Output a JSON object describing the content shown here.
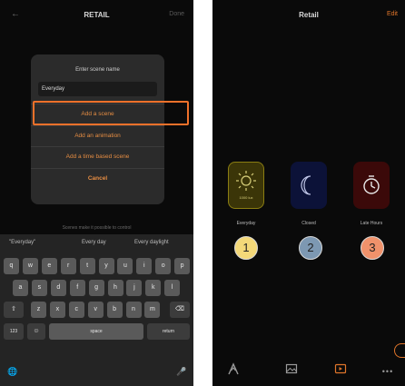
{
  "left_screen": {
    "header": {
      "back_icon": "arrow-left-icon",
      "title": "RETAIL",
      "done_label": "Done"
    },
    "dialog": {
      "title": "Enter scene name",
      "input_value": "Everyday",
      "options": [
        "Add a scene",
        "Add an animation",
        "Add a time based scene"
      ],
      "cancel_label": "Cancel"
    },
    "hint": "Scenes make it possible to control",
    "keyboard": {
      "suggestions": [
        "\"Everyday\"",
        "Every day",
        "Every daylight"
      ],
      "row1": [
        "q",
        "w",
        "e",
        "r",
        "t",
        "y",
        "u",
        "i",
        "o",
        "p"
      ],
      "row2": [
        "a",
        "s",
        "d",
        "f",
        "g",
        "h",
        "j",
        "k",
        "l"
      ],
      "row3": [
        "z",
        "x",
        "c",
        "v",
        "b",
        "n",
        "m"
      ],
      "numbers_label": "123",
      "space_label": "space",
      "return_label": "return"
    },
    "highlight_color": "#f0712a"
  },
  "right_screen": {
    "header": {
      "title": "Retail",
      "edit_label": "Edit"
    },
    "scenes": [
      {
        "label": "Everyday",
        "icon": "sun-icon",
        "lux": "1000 lux",
        "color": "#8a7d12"
      },
      {
        "label": "Closed",
        "icon": "moon-icon",
        "color": "#0c1238"
      },
      {
        "label": "Late Hours",
        "icon": "timer-icon",
        "color": "#3b0909"
      }
    ],
    "badges": [
      "1",
      "2",
      "3"
    ],
    "tabs": [
      {
        "icon": "logo-icon",
        "active": false
      },
      {
        "icon": "gallery-icon",
        "active": false
      },
      {
        "icon": "scenes-icon",
        "active": true
      },
      {
        "icon": "more-icon",
        "active": false
      }
    ],
    "accent": "#e0752a"
  }
}
